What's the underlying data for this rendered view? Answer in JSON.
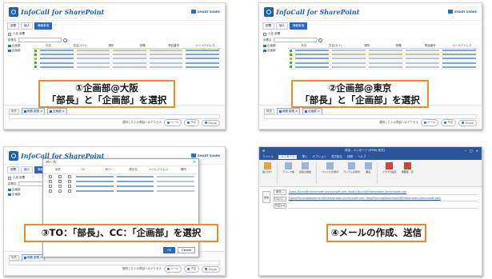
{
  "app": {
    "logo_text": "InfoCall for SharePoint",
    "brand_text": "SMART SHARE",
    "tabs": [
      "部署",
      "個人",
      "情報事項"
    ],
    "checkbox_label": "人足 部署",
    "search_label": "部署名"
  },
  "columns": [
    "氏名",
    "氏名(カナ)",
    "場所",
    "役職",
    "電話番号",
    "メールアドレス"
  ],
  "tree": [
    "企画部",
    "企画部"
  ],
  "footer": {
    "label": "宛先",
    "chips": [
      "総務 部長 ×",
      "企画部 ×"
    ],
    "notice": "選択した人の電話へのアクセス",
    "buttons": [
      "メール",
      "予定",
      "Skype"
    ]
  },
  "dialog": {
    "title": "メール",
    "close": "×",
    "columns": [
      "宛先",
      "CC",
      "BCC",
      "表示名",
      "メールアドレス",
      "場所"
    ],
    "ok": "OK",
    "cancel": "Cancel"
  },
  "outlook": {
    "title": "件名 - メッセージ (HTML 形式)",
    "ribbon_tabs": [
      "ファイル",
      "メッセージ",
      "挿入",
      "オプション",
      "書式設定",
      "校閲",
      "ヘルプ"
    ],
    "ribbon_buttons": [
      "貼り付け",
      "アドレス帳",
      "名前の確認",
      "ファイルの添付",
      "アイテムの添付",
      "署名",
      "フラグの設定",
      "重要度 - 高"
    ],
    "send": "送信",
    "to_label": "宛先...",
    "cc_label": "CC(C)...",
    "subject_label": "件名(U)",
    "to_value": "Sodou.Bucho@infoharraden.onmicrosoft.com; Kikaku.Bucho@infoharraden.onmicrosoft.com",
    "cc_value": "OsakaPlanningDepartment@infoharraden.onmicrosoft.com; TokyoPlanningDepartment@infoharraden.onmicrosoft.com"
  },
  "callouts": {
    "c1_line1": "①企画部@大阪",
    "c1_line2": "「部長」と「企画部」を選択",
    "c2_line1": "②企画部@東京",
    "c2_line2": "「部長」と「企画部」を選択",
    "c3": "③TO：「部長」、CC：「企画部」を選択",
    "c4": "④メールの作成、送信"
  },
  "colors": {
    "accent": "#2e66c6",
    "callout_border": "#f08a24",
    "outlook_blue": "#2b579a"
  }
}
